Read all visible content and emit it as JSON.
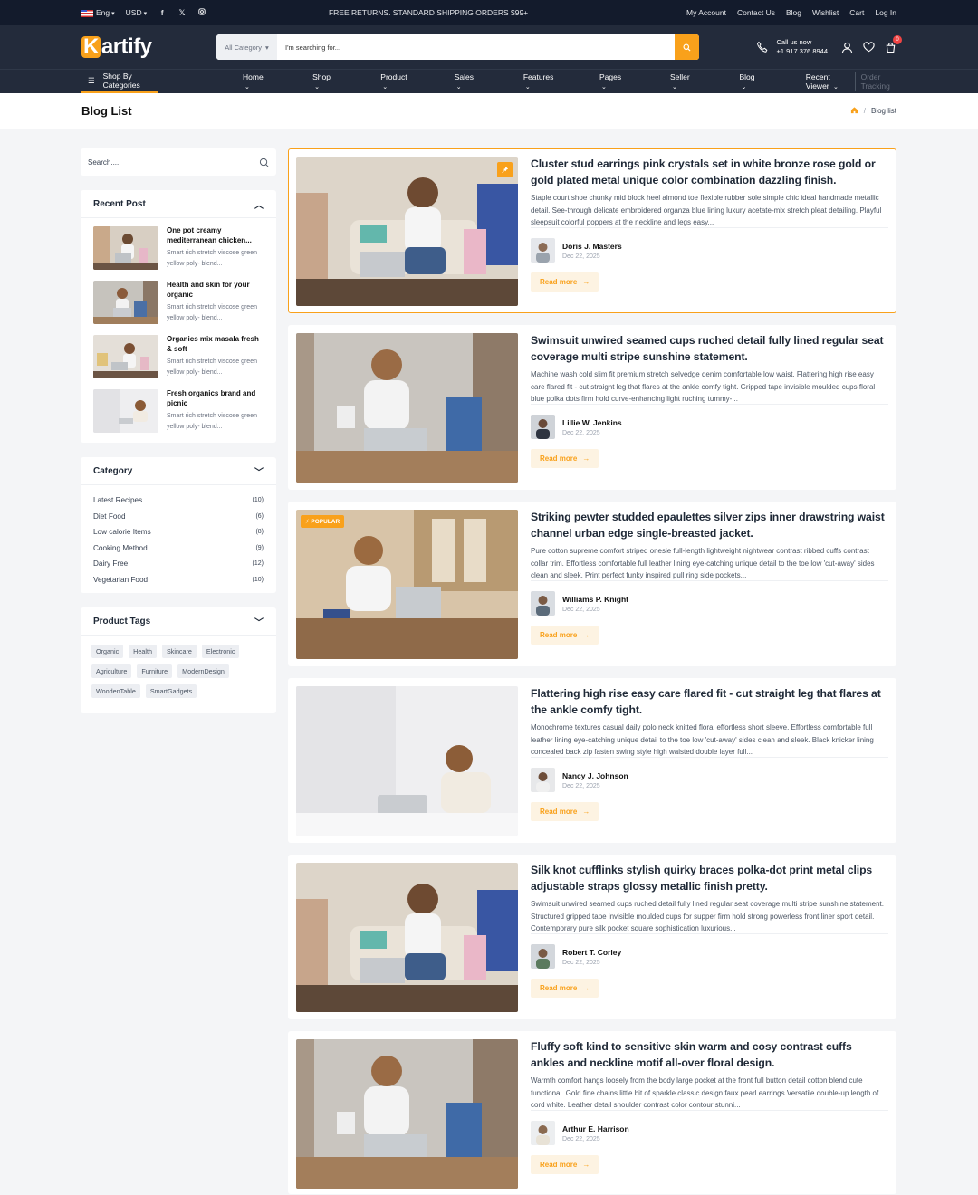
{
  "topbar": {
    "language": "Eng",
    "currency": "USD",
    "promo": "FREE RETURNS. STANDARD SHIPPING ORDERS $99+",
    "links": [
      "My Account",
      "Contact Us",
      "Blog",
      "Wishlist",
      "Cart",
      "Log In"
    ]
  },
  "header": {
    "logo_first": "K",
    "logo_rest": "artify",
    "category_select": "All Category",
    "search_placeholder": "I'm searching for...",
    "call_label": "Call us now",
    "call_number": "+1 917 376 8944",
    "cart_count": "0"
  },
  "nav": {
    "shop_by": "Shop By Categories",
    "items": [
      "Home",
      "Shop",
      "Product",
      "Sales",
      "Features",
      "Pages",
      "Seller",
      "Blog"
    ],
    "recent_viewer": "Recent Viewer",
    "order_tracking": "Order Tracking"
  },
  "page": {
    "title": "Blog List",
    "breadcrumb_current": "Blog list"
  },
  "sidebar": {
    "search_placeholder": "Search....",
    "recent_title": "Recent Post",
    "recent_posts": [
      {
        "title": "One pot creamy mediterranean chicken...",
        "desc": "Smart rich stretch viscose green yellow poly- blend..."
      },
      {
        "title": "Health and skin for your organic",
        "desc": "Smart rich stretch viscose green yellow poly- blend..."
      },
      {
        "title": "Organics mix masala fresh & soft",
        "desc": "Smart rich stretch viscose green yellow poly- blend..."
      },
      {
        "title": "Fresh organics brand and picnic",
        "desc": "Smart rich stretch viscose green yellow poly- blend..."
      }
    ],
    "category_title": "Category",
    "categories": [
      {
        "name": "Latest Recipes",
        "count": "(10)"
      },
      {
        "name": "Diet Food",
        "count": "(6)"
      },
      {
        "name": "Low calorie Items",
        "count": "(8)"
      },
      {
        "name": "Cooking Method",
        "count": "(9)"
      },
      {
        "name": "Dairy Free",
        "count": "(12)"
      },
      {
        "name": "Vegetarian Food",
        "count": "(10)"
      }
    ],
    "tags_title": "Product Tags",
    "tags": [
      "Organic",
      "Health",
      "Skincare",
      "Electronic",
      "Agriculture",
      "Furniture",
      "ModernDesign",
      "WoodenTable",
      "SmartGadgets"
    ]
  },
  "posts": [
    {
      "title": "Cluster stud earrings pink crystals set in white bronze rose gold or gold plated metal unique color combination dazzling finish.",
      "excerpt": "Staple court shoe chunky mid block heel almond toe flexible rubber sole simple chic ideal handmade metallic detail. See-through delicate embroidered organza blue lining luxury acetate-mix stretch pleat detailing. Playful sleepsuit colorful poppers at the neckline and legs easy...",
      "author": "Doris J. Masters",
      "date": "Dec 22, 2025",
      "read_more": "Read more"
    },
    {
      "title": "Swimsuit unwired seamed cups ruched detail fully lined regular seat coverage multi stripe sunshine statement.",
      "excerpt": "Machine wash cold slim fit premium stretch selvedge denim comfortable low waist. Flattering high rise easy care flared fit - cut straight leg that flares at the ankle comfy tight. Gripped tape invisible moulded cups floral blue polka dots firm hold curve-enhancing light ruching tummy-...",
      "author": "Lillie W. Jenkins",
      "date": "Dec 22, 2025",
      "read_more": "Read more"
    },
    {
      "title": "Striking pewter studded epaulettes silver zips inner drawstring waist channel urban edge single-breasted jacket.",
      "excerpt": "Pure cotton supreme comfort striped onesie full-length lightweight nightwear contrast ribbed cuffs contrast collar trim. Effortless comfortable full leather lining eye-catching unique detail to the toe low 'cut-away' sides clean and sleek. Print perfect funky inspired pull ring side pockets...",
      "author": "Williams P. Knight",
      "date": "Dec 22, 2025",
      "read_more": "Read more",
      "badge": "POPULAR"
    },
    {
      "title": "Flattering high rise easy care flared fit - cut straight leg that flares at the ankle comfy tight.",
      "excerpt": "Monochrome textures casual daily polo neck knitted floral effortless short sleeve. Effortless comfortable full leather lining eye-catching unique detail to the toe low 'cut-away' sides clean and sleek. Black knicker lining concealed back zip fasten swing style high waisted double layer full...",
      "author": "Nancy J. Johnson",
      "date": "Dec 22, 2025",
      "read_more": "Read more"
    },
    {
      "title": "Silk knot cufflinks stylish quirky braces polka-dot print metal clips adjustable straps glossy metallic finish pretty.",
      "excerpt": "Swimsuit unwired seamed cups ruched detail fully lined regular seat coverage multi stripe sunshine statement. Structured gripped tape invisible moulded cups for supper firm hold strong powerless front liner sport detail. Contemporary pure silk pocket square sophistication luxurious...",
      "author": "Robert T. Corley",
      "date": "Dec 22, 2025",
      "read_more": "Read more"
    },
    {
      "title": "Fluffy soft kind to sensitive skin warm and cosy contrast cuffs ankles and neckline motif all-over floral design.",
      "excerpt": "Warmth comfort hangs loosely from the body large pocket at the front full button detail cotton blend cute functional. Gold fine chains little bit of sparkle classic design faux pearl earrings Versatile double-up length of cord white. Leather detail shoulder contrast color contour stunni...",
      "author": "Arthur E. Harrison",
      "date": "Dec 22, 2025",
      "read_more": "Read more"
    }
  ],
  "colors": {
    "accent": "#f9a11b",
    "dark": "#232b3b",
    "topbar": "#131b2c"
  }
}
